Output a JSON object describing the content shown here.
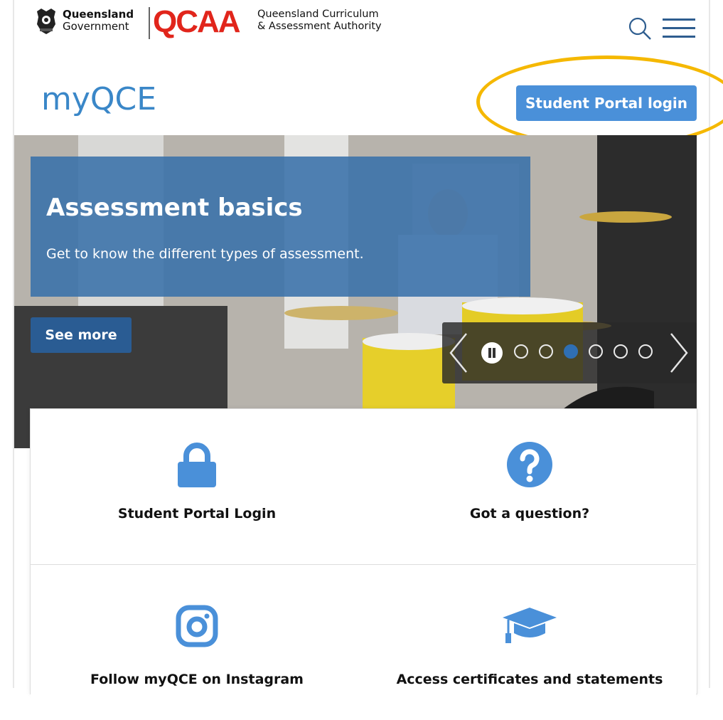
{
  "header": {
    "gov_line1": "Queensland",
    "gov_line2": "Government",
    "qcaa_mark": "QCAA",
    "qcaa_line1": "Queensland Curriculum",
    "qcaa_line2": "& Assessment Authority",
    "search_icon": "search-icon",
    "menu_icon": "hamburger-menu-icon"
  },
  "site": {
    "title": "myQCE",
    "portal_button": "Student Portal login"
  },
  "hero": {
    "title": "Assessment basics",
    "subtitle": "Get to know the different types of assessment.",
    "cta": "See more",
    "slide_count": 6,
    "active_slide": 3
  },
  "tiles": [
    {
      "label": "Student Portal Login",
      "icon": "lock-icon"
    },
    {
      "label": "Got a question?",
      "icon": "question-circle-icon"
    },
    {
      "label": "Follow myQCE on Instagram",
      "icon": "instagram-icon"
    },
    {
      "label": "Access certificates and statements",
      "icon": "graduation-cap-icon"
    }
  ],
  "colors": {
    "brand_blue": "#3a87c8",
    "button_blue": "#4a90d9",
    "qcaa_red": "#e1251b",
    "highlight": "#f5b800"
  }
}
